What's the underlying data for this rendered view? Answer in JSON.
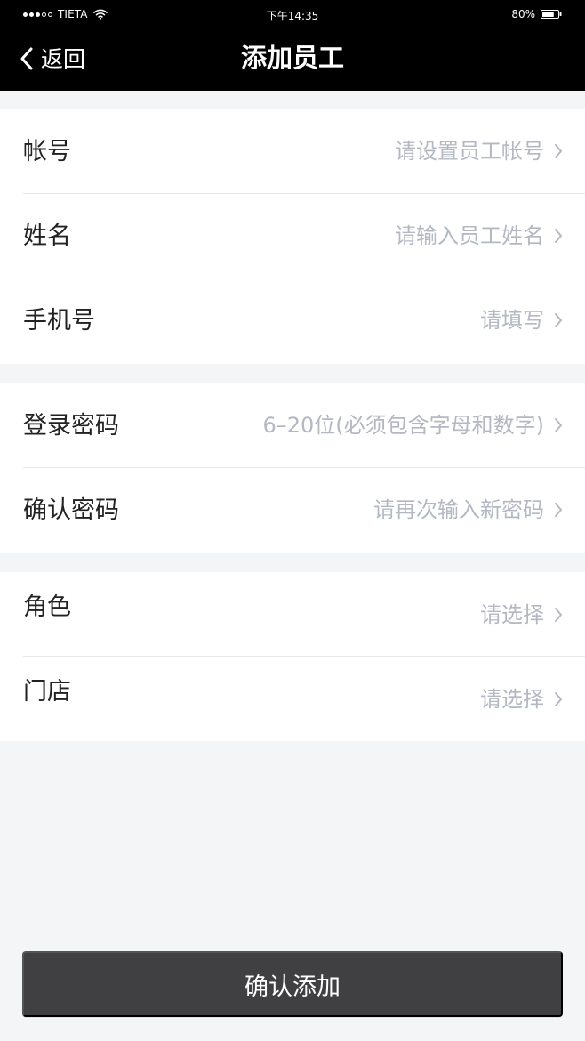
{
  "status_bar": {
    "carrier": "TIETA",
    "time": "下午14:35",
    "battery_percent": "80%",
    "battery_level": 0.8
  },
  "nav": {
    "back_label": "返回",
    "title": "添加员工"
  },
  "form": {
    "section_1": [
      {
        "label": "帐号",
        "placeholder": "请设置员工帐号"
      },
      {
        "label": "姓名",
        "placeholder": "请输入员工姓名"
      },
      {
        "label": "手机号",
        "placeholder": "请填写"
      }
    ],
    "section_2": [
      {
        "label": "登录密码",
        "placeholder": "6–20位(必须包含字母和数字)"
      },
      {
        "label": "确认密码",
        "placeholder": "请再次输入新密码"
      }
    ],
    "section_3": [
      {
        "label": "角色",
        "placeholder": "请选择"
      },
      {
        "label": "门店",
        "placeholder": "请选择"
      }
    ]
  },
  "confirm_button_label": "确认添加",
  "colors": {
    "navbar_bg": "#000000",
    "page_bg": "#f4f5f7",
    "placeholder_text": "#b3b8c2",
    "button_bg": "#404043"
  }
}
